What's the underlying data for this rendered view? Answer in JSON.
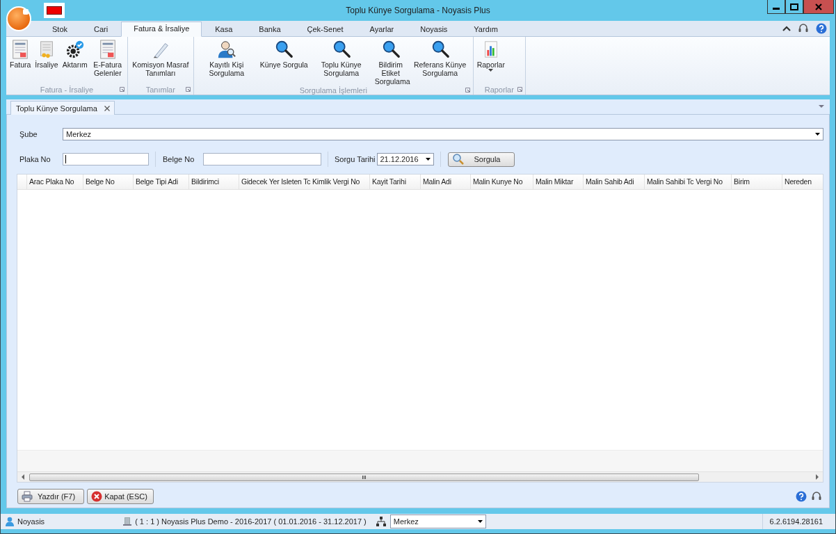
{
  "window": {
    "title": "Toplu Künye Sorgulama - Noyasis Plus"
  },
  "ribbon_tabs": [
    {
      "label": "Stok",
      "selected": false
    },
    {
      "label": "Cari",
      "selected": false
    },
    {
      "label": "Fatura & İrsaliye",
      "selected": true
    },
    {
      "label": "Kasa",
      "selected": false
    },
    {
      "label": "Banka",
      "selected": false
    },
    {
      "label": "Çek-Senet",
      "selected": false
    },
    {
      "label": "Ayarlar",
      "selected": false
    },
    {
      "label": "Noyasis",
      "selected": false
    },
    {
      "label": "Yardım",
      "selected": false
    }
  ],
  "ribbon_groups": [
    {
      "label": "Fatura - İrsaliye",
      "items": [
        {
          "label": "Fatura",
          "kind": "invoice"
        },
        {
          "label": "İrsaliye",
          "kind": "waybill"
        },
        {
          "label": "Aktarım",
          "kind": "gear"
        },
        {
          "label": "E-Fatura Gelenler",
          "kind": "invoice"
        }
      ]
    },
    {
      "label": "Tanımlar",
      "items": [
        {
          "label": "Komisyon Masraf Tanımları",
          "kind": "pencil"
        }
      ]
    },
    {
      "label": "Sorgulama İşlemleri",
      "items": [
        {
          "label": "Kayıtlı Kişi Sorgulama",
          "kind": "person"
        },
        {
          "label": "Künye Sorgula",
          "kind": "search"
        },
        {
          "label": "Toplu Künye Sorgulama",
          "kind": "search"
        },
        {
          "label": "Bildirim Etiket Sorgulama",
          "kind": "search"
        },
        {
          "label": "Referans Künye Sorgulama",
          "kind": "search"
        }
      ]
    },
    {
      "label": "Raporlar",
      "items": [
        {
          "label": "Raporlar",
          "kind": "chart",
          "dropdown": true
        }
      ]
    }
  ],
  "document_tab": {
    "label": "Toplu Künye Sorgulama"
  },
  "form": {
    "sube_label": "Şube",
    "sube_value": "Merkez",
    "plaka_label": "Plaka No",
    "belge_label": "Belge No",
    "tarih_label": "Sorgu Tarihi",
    "tarih_value": "21.12.2016",
    "query_button": "Sorgula"
  },
  "table": {
    "columns": [
      "Arac Plaka No",
      "Belge No",
      "Belge Tipi Adi",
      "Bildirimci",
      "Gidecek Yer Isleten Tc Kimlik Vergi No",
      "Kayit Tarihi",
      "Malin Adi",
      "Malin Kunye No",
      "Malin Miktar",
      "Malin Sahib Adi",
      "Malin Sahibi Tc Vergi No",
      "Birim",
      "Nereden"
    ]
  },
  "buttons": [
    {
      "label": "Yazdır (F7)",
      "kind": "print"
    },
    {
      "label": "Kapat (ESC)",
      "kind": "close"
    }
  ],
  "status_bar": {
    "user": "Noyasis",
    "database": "( 1 : 1 )  Noyasis Plus Demo - 2016-2017  ( 01.01.2016 - 31.12.2017 )",
    "branch": "Merkez",
    "version": "6.2.6194.28161"
  }
}
